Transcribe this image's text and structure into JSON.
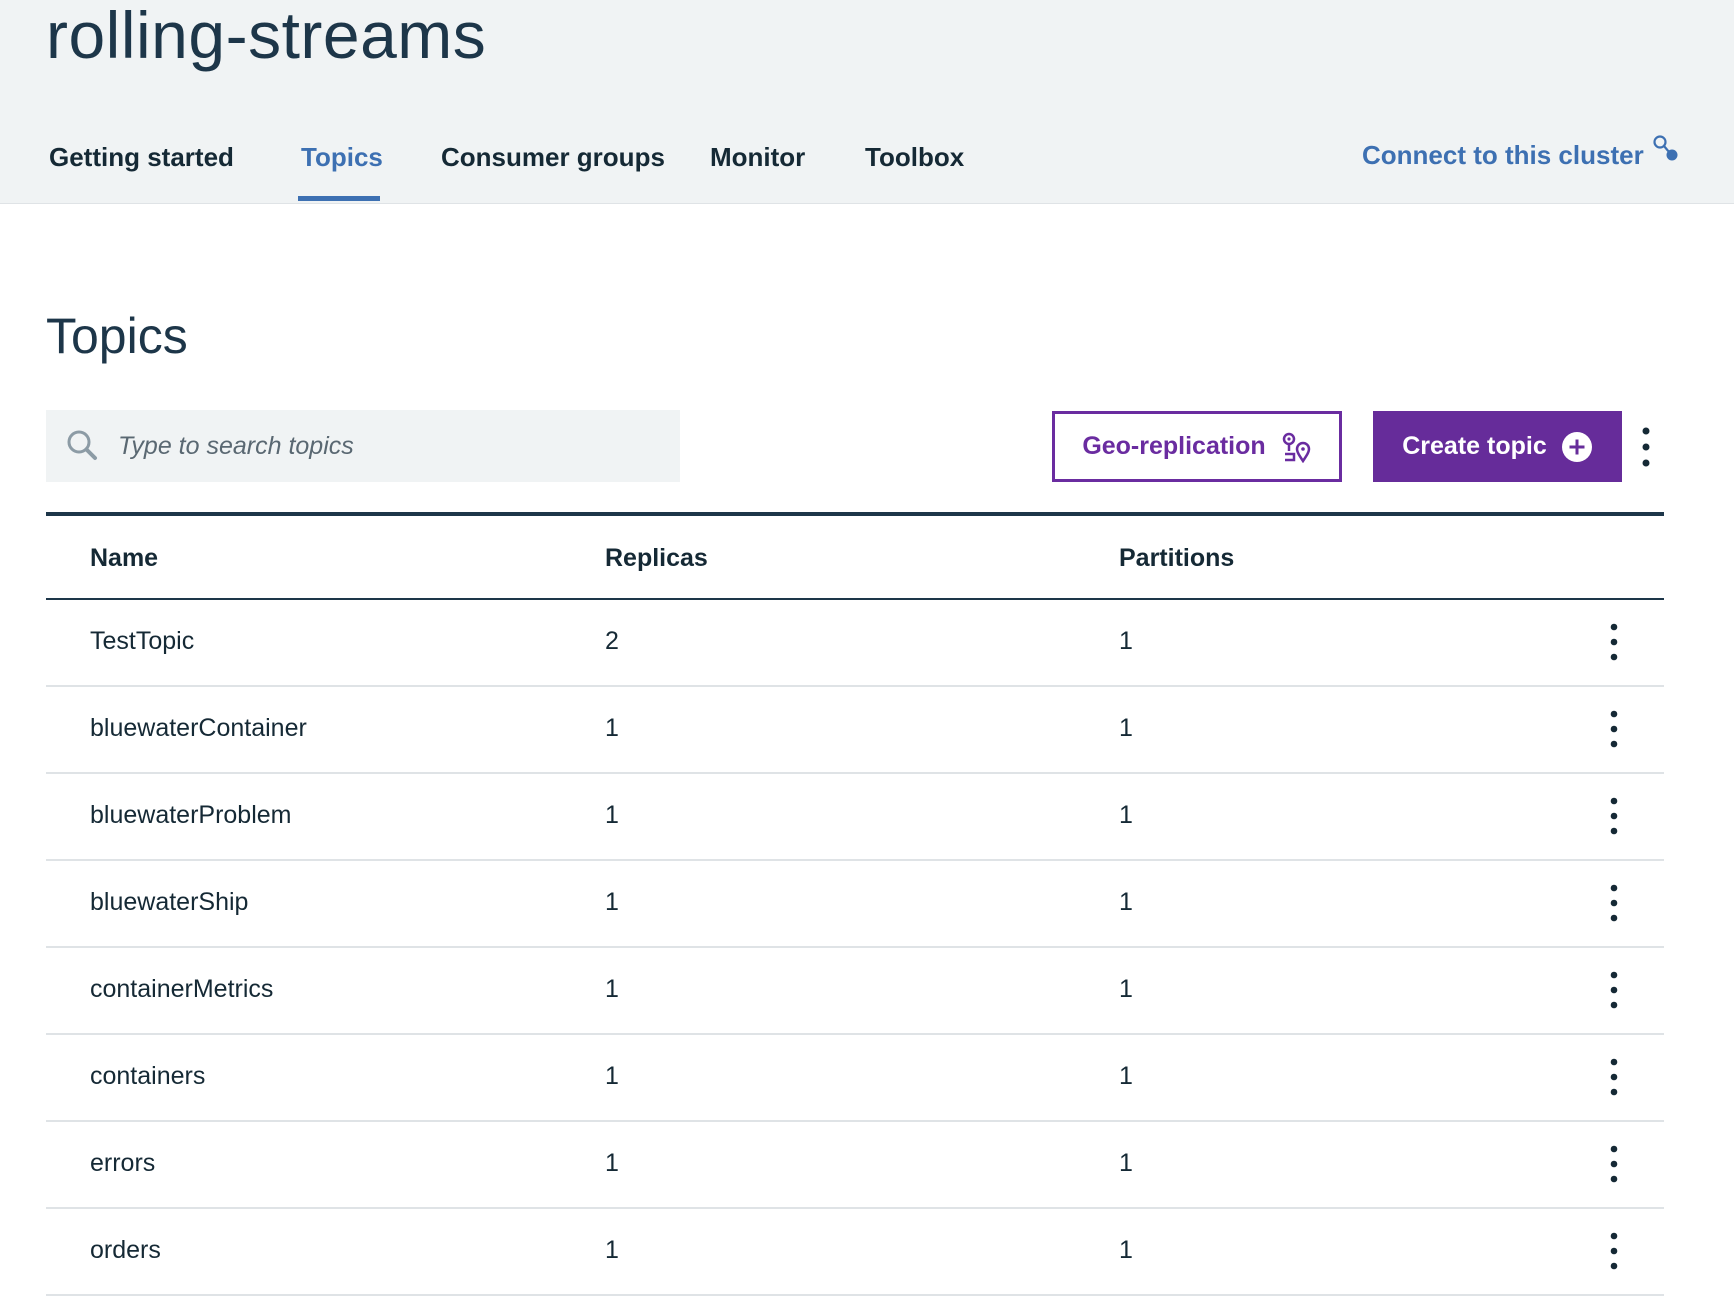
{
  "header": {
    "cluster_name": "rolling-streams",
    "tabs": [
      {
        "label": "Getting started",
        "active": false
      },
      {
        "label": "Topics",
        "active": true
      },
      {
        "label": "Consumer groups",
        "active": false
      },
      {
        "label": "Monitor",
        "active": false
      },
      {
        "label": "Toolbox",
        "active": false
      }
    ],
    "connect_label": "Connect to this cluster",
    "connect_icon": "connect-icon"
  },
  "main": {
    "title": "Topics",
    "search": {
      "placeholder": "Type to search topics",
      "value": "",
      "icon": "search-icon"
    },
    "geo_button": {
      "label": "Geo-replication",
      "icon": "geo-location-icon"
    },
    "create_button": {
      "label": "Create topic",
      "icon": "add-circle-icon"
    },
    "overflow_icon": "overflow-menu-vertical-icon"
  },
  "table": {
    "columns": [
      "Name",
      "Replicas",
      "Partitions"
    ],
    "rows": [
      {
        "name": "TestTopic",
        "replicas": "2",
        "partitions": "1"
      },
      {
        "name": "bluewaterContainer",
        "replicas": "1",
        "partitions": "1"
      },
      {
        "name": "bluewaterProblem",
        "replicas": "1",
        "partitions": "1"
      },
      {
        "name": "bluewaterShip",
        "replicas": "1",
        "partitions": "1"
      },
      {
        "name": "containerMetrics",
        "replicas": "1",
        "partitions": "1"
      },
      {
        "name": "containers",
        "replicas": "1",
        "partitions": "1"
      },
      {
        "name": "errors",
        "replicas": "1",
        "partitions": "1"
      },
      {
        "name": "orders",
        "replicas": "1",
        "partitions": "1"
      }
    ]
  },
  "colors": {
    "header_bg": "#f0f3f4",
    "active_tab": "#3d70b2",
    "primary_purple": "#662c9a",
    "text_dark": "#152935"
  }
}
